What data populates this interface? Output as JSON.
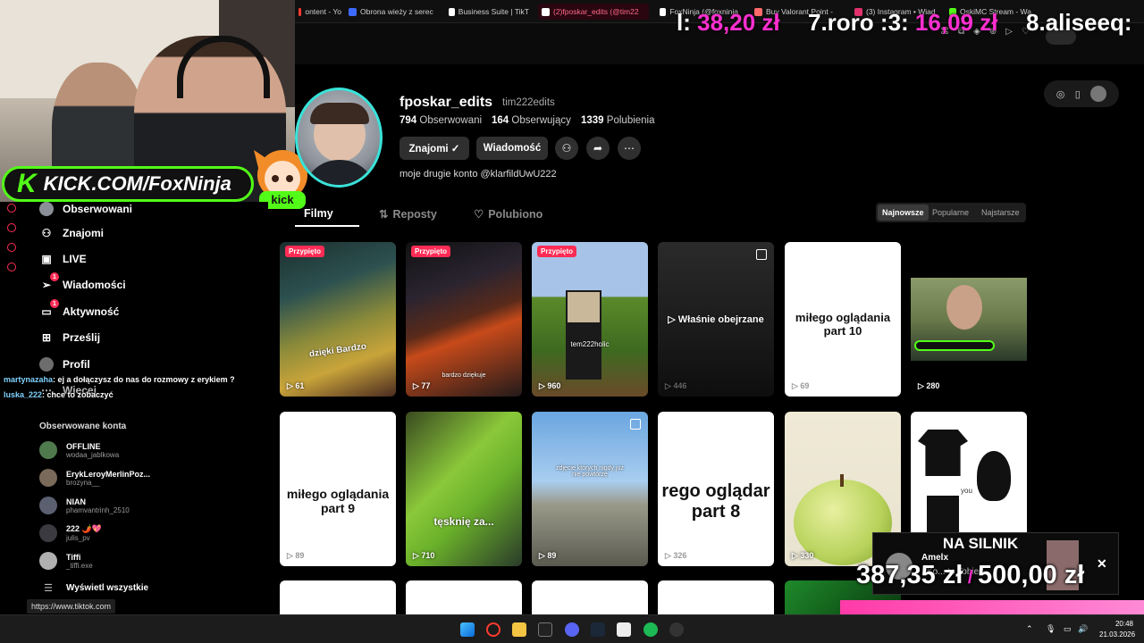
{
  "browser": {
    "tabs": [
      {
        "label": "ontent - Yo",
        "active": false,
        "color": "#ff3b30"
      },
      {
        "label": "Obrona wieży z serec",
        "active": false,
        "color": "#3d6bff"
      },
      {
        "label": "Business Suite | TikT",
        "active": false,
        "color": "#ffffff"
      },
      {
        "label": "(2)fposkar_edits (@tim22",
        "active": true,
        "color": "#ffffff"
      },
      {
        "label": "FoxNinja (@foxninja",
        "active": false,
        "color": "#ffffff"
      },
      {
        "label": "Buy Valorant Point -",
        "active": false,
        "color": "#ff6b6b"
      },
      {
        "label": "(3) Instagram • Wiad",
        "active": false,
        "color": "#e1306c"
      },
      {
        "label": "OskiMC Stream - Wa",
        "active": false,
        "color": "#53fc18"
      }
    ]
  },
  "leaderboard": [
    {
      "rank": "l:",
      "amount": "38,20 zł"
    },
    {
      "rank": "7.roro :3:",
      "amount": "16,09 zł"
    },
    {
      "rank": "8.aliseeq:",
      "amount": ""
    }
  ],
  "kick_banner": {
    "k": "K",
    "text": "KICK.COM/FoxNinja",
    "mascot_label": "kick"
  },
  "sidebar": {
    "nav": [
      {
        "label": "Obserwowani",
        "icon": "avatar-icon"
      },
      {
        "label": "Znajomi",
        "icon": "friends-icon"
      },
      {
        "label": "LIVE",
        "icon": "live-tv-icon"
      },
      {
        "label": "Wiadomości",
        "icon": "messages-icon",
        "badge": "1"
      },
      {
        "label": "Aktywność",
        "icon": "activity-icon",
        "badge": "1"
      },
      {
        "label": "Prześlij",
        "icon": "upload-icon"
      },
      {
        "label": "Profil",
        "icon": "profile-icon"
      },
      {
        "label": "Więcej",
        "icon": "more-icon"
      }
    ],
    "following_title": "Obserwowane konta",
    "accounts": [
      {
        "name": "OFFLINE",
        "handle": "wodaa_jablkowa"
      },
      {
        "name": "ErykLeroyMerlinPoz...",
        "handle": "brozyna__"
      },
      {
        "name": "NIAN",
        "handle": "phamvantrinh_2510"
      },
      {
        "name": "222 🌶️💖",
        "handle": "julis_pv"
      },
      {
        "name": "Tiffi",
        "handle": "_tiffi.exe"
      }
    ],
    "show_all": "Wyświetl wszystkie"
  },
  "chat": [
    {
      "user": "martynazaha",
      "msg": ": ej a dołączysz do nas do rozmowy z erykiem ?"
    },
    {
      "user": "luska_222",
      "msg": ": chce to zobaczyć"
    }
  ],
  "profile": {
    "username": "fposkar_edits",
    "nickname": "tim222edits",
    "following_count": "794",
    "following_label": "Obserwowani",
    "followers_count": "164",
    "followers_label": "Obserwujący",
    "likes_count": "1339",
    "likes_label": "Polubienia",
    "btn_friends": "Znajomi ✓",
    "btn_message": "Wiadomość",
    "bio": "moje drugie konto @klarfildUwU222"
  },
  "content_tabs": {
    "videos": "Filmy",
    "reposts": "Reposty",
    "liked": "Polubiono"
  },
  "sort": {
    "newest": "Najnowsze",
    "popular": "Popularne",
    "oldest": "Najstarsze"
  },
  "videos": [
    {
      "views": "61",
      "pinned": "Przypięto",
      "overlay": "dzięki Bardzo",
      "style": "game"
    },
    {
      "views": "77",
      "pinned": "Przypięto",
      "overlay": "bardzo dziękuje",
      "style": "stream"
    },
    {
      "views": "960",
      "pinned": "Przypięto",
      "overlay": "tem222holic",
      "style": "mc"
    },
    {
      "views": "446",
      "pinned": "",
      "overlay": "Właśnie obejrzane",
      "style": "dark"
    },
    {
      "views": "69",
      "pinned": "",
      "overlay": "miłego oglądania part 10",
      "style": "white"
    },
    {
      "views": "280",
      "pinned": "",
      "overlay": "",
      "style": "webcam"
    },
    {
      "views": "89",
      "pinned": "",
      "overlay": "miłego oglądania part 9",
      "style": "white"
    },
    {
      "views": "710",
      "pinned": "",
      "overlay": "tęsknię za...",
      "style": "green"
    },
    {
      "views": "89",
      "pinned": "",
      "overlay": "zdjęcie których nigdy już nie powtórzę",
      "style": "sky"
    },
    {
      "views": "326",
      "pinned": "",
      "overlay": "rego oglądar part  8",
      "style": "white"
    },
    {
      "views": "330",
      "pinned": "",
      "overlay": "",
      "style": "apple"
    },
    {
      "views": "",
      "pinned": "",
      "overlay": "you",
      "style": "clothes"
    }
  ],
  "donation": {
    "title": "NA SILNIK",
    "user": "Amelx",
    "amount": "387,35 zł",
    "slash": "/",
    "goal": "500,00 zł",
    "msg": "Ko... to Tobie"
  },
  "status_url": "https://www.tiktok.com",
  "clock": {
    "time": "20:48",
    "date": "21.03.2026"
  },
  "colors": {
    "accent": "#fe2c55",
    "kick": "#53fc18",
    "leaderboard": "#ff2fd0"
  }
}
